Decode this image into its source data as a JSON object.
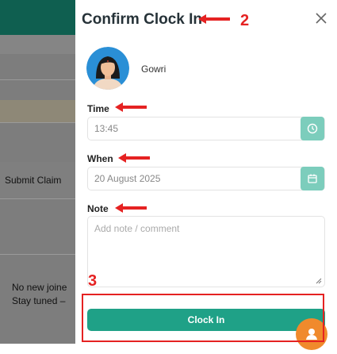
{
  "background": {
    "submit_claim": "Submit Claim",
    "no_new_line1": "No new joine",
    "no_new_line2": "Stay tuned –"
  },
  "drawer": {
    "title": "Confirm Clock In",
    "user": {
      "name": "Gowri"
    },
    "time": {
      "label": "Time",
      "value": "13:45"
    },
    "when": {
      "label": "When",
      "value": "20 August 2025"
    },
    "note": {
      "label": "Note",
      "placeholder": "Add note / comment"
    },
    "submit_label": "Clock In"
  },
  "annotations": {
    "step2": "2",
    "step3": "3"
  },
  "colors": {
    "accent": "#1fa187",
    "icon_bg": "#7ccdbc",
    "annotation": "#e52222",
    "fab": "#f08a2c"
  },
  "icons": [
    "close-icon",
    "clock-icon",
    "calendar-icon",
    "resize-handle-icon",
    "user-icon"
  ]
}
